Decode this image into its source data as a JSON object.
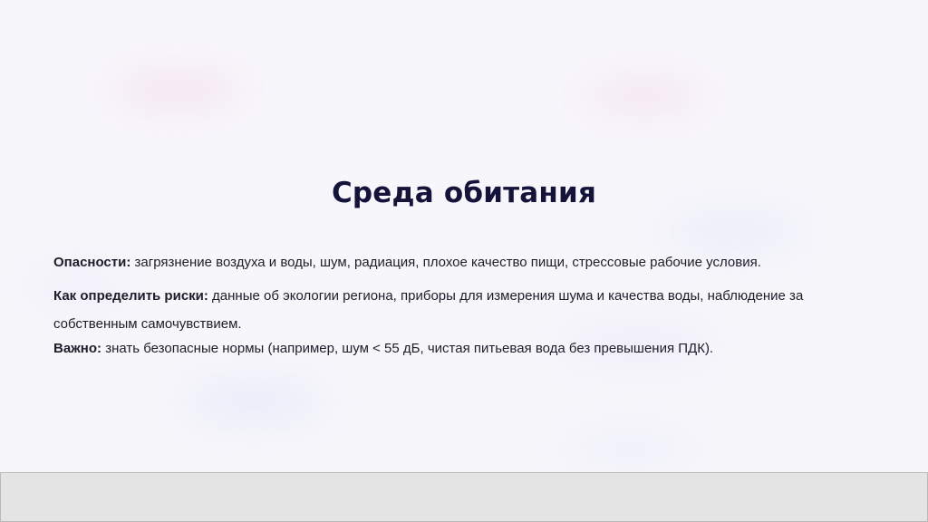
{
  "slide": {
    "title": "Среда обитания",
    "paragraphs": [
      {
        "label": "Опасности:",
        "text": " загрязнение воздуха и воды, шум, радиация, плохое качество пищи, стрессовые рабочие условия."
      },
      {
        "label": "Как определить риски:",
        "text": " данные об экологии региона, приборы для измерения шума и качества воды, наблюдение за собственным самочувствием."
      },
      {
        "label": "Важно:",
        "text": " знать безопасные нормы (например, шум < 55 дБ, чистая питьевая вода без превышения ПДК)."
      }
    ]
  },
  "colors": {
    "title": "#14133a",
    "text": "#1e1d2a",
    "background": "#f7f6fb",
    "footer": "#e4e4e4"
  }
}
